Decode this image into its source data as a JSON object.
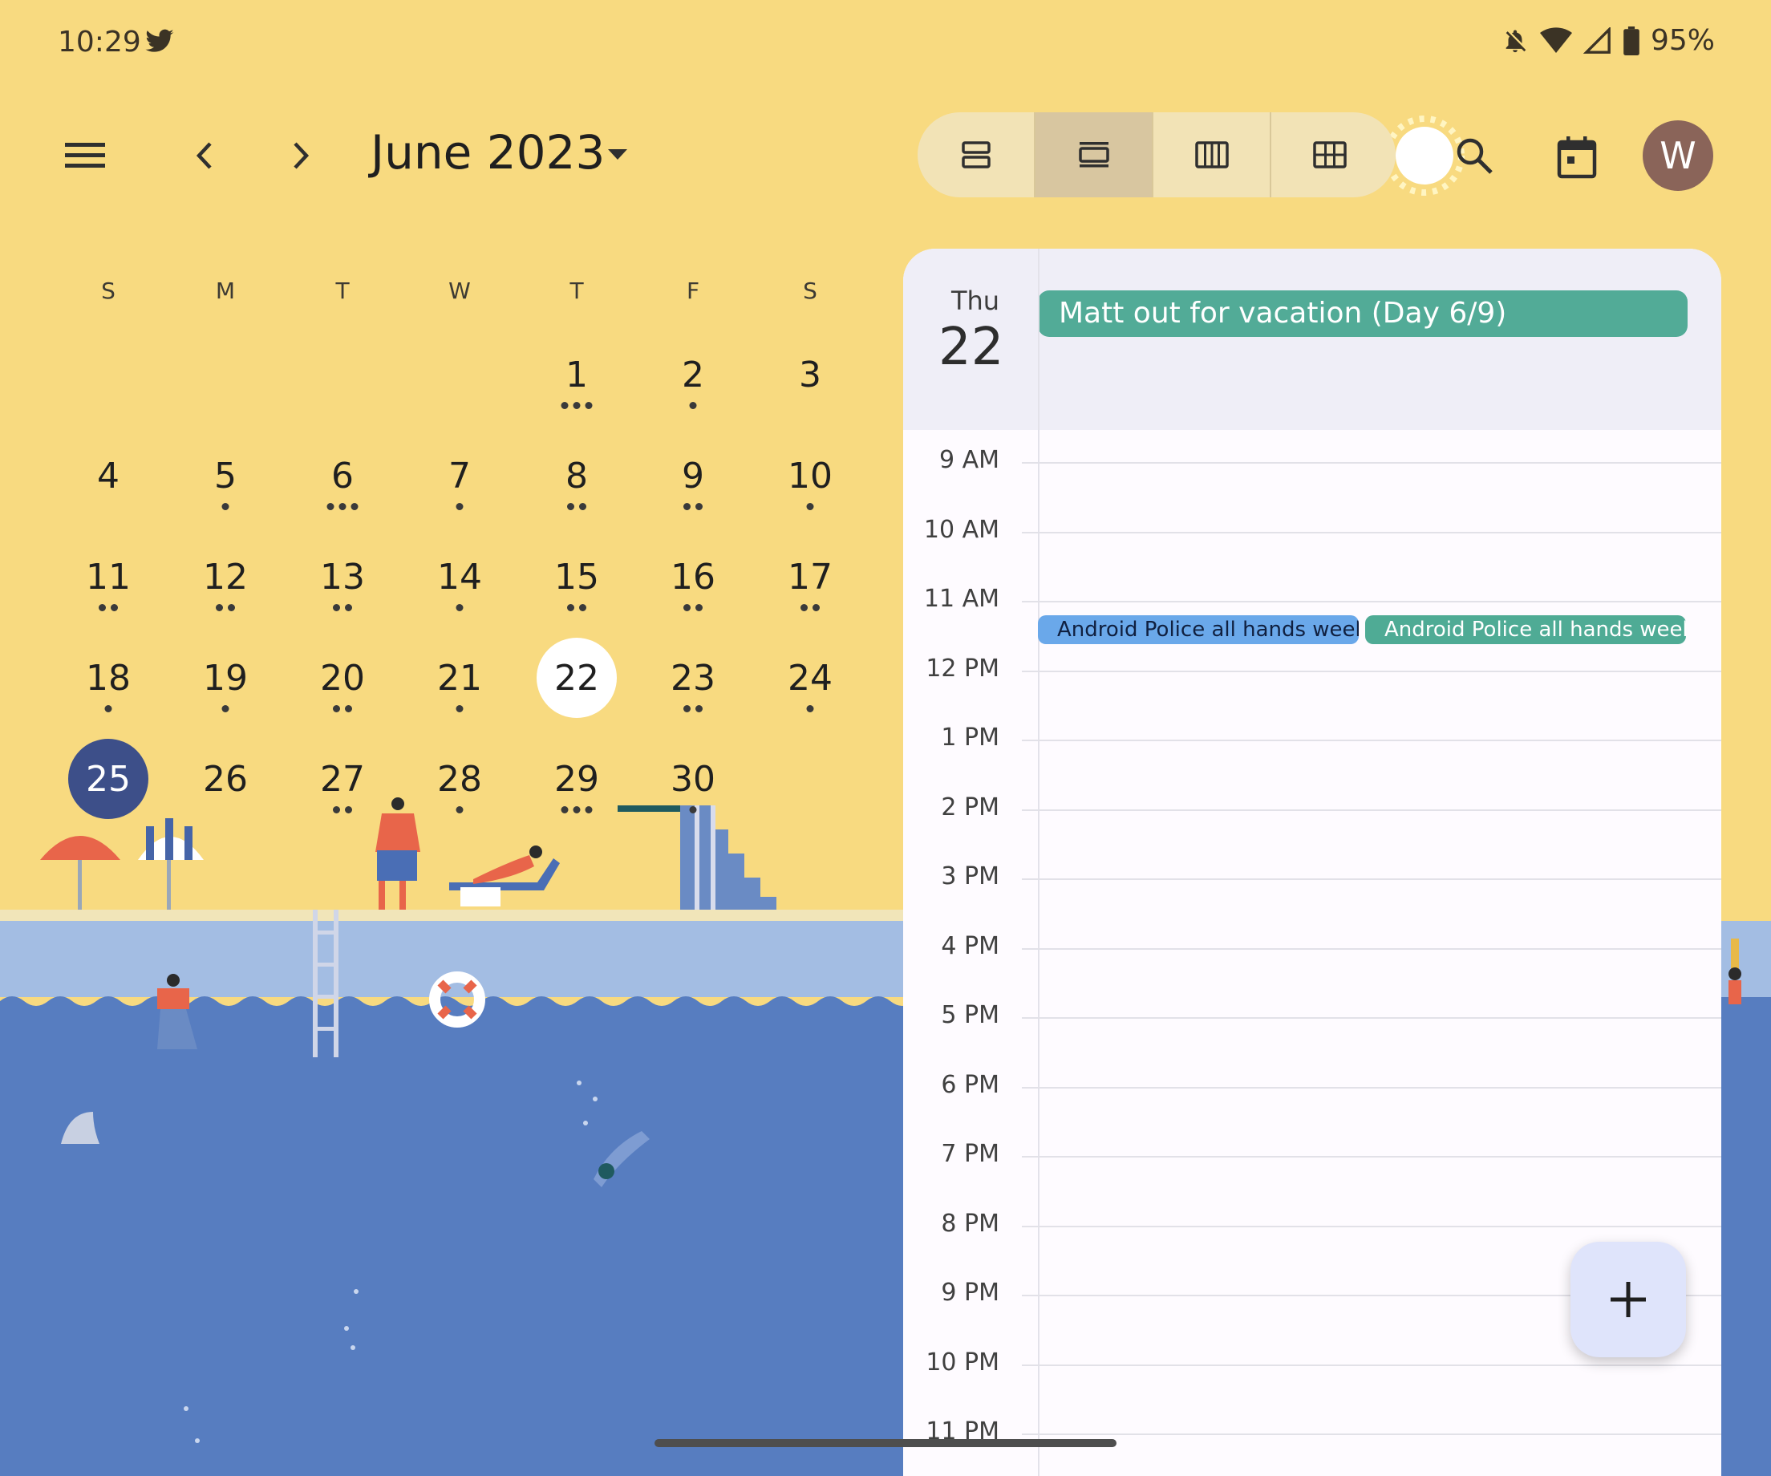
{
  "status_bar": {
    "time": "10:29",
    "battery": "95%"
  },
  "header": {
    "month_title": "June 2023",
    "avatar_letter": "W"
  },
  "view_modes": [
    "schedule-view",
    "day-view",
    "week-view",
    "month-view"
  ],
  "mini_calendar": {
    "weekdays": [
      "S",
      "M",
      "T",
      "W",
      "T",
      "F",
      "S"
    ],
    "weeks": [
      [
        {
          "day": "",
          "dots": 0
        },
        {
          "day": "",
          "dots": 0
        },
        {
          "day": "",
          "dots": 0
        },
        {
          "day": "",
          "dots": 0
        },
        {
          "day": "1",
          "dots": 3
        },
        {
          "day": "2",
          "dots": 1
        },
        {
          "day": "3",
          "dots": 0
        }
      ],
      [
        {
          "day": "4",
          "dots": 0
        },
        {
          "day": "5",
          "dots": 1
        },
        {
          "day": "6",
          "dots": 3
        },
        {
          "day": "7",
          "dots": 1
        },
        {
          "day": "8",
          "dots": 2
        },
        {
          "day": "9",
          "dots": 2
        },
        {
          "day": "10",
          "dots": 1
        }
      ],
      [
        {
          "day": "11",
          "dots": 2
        },
        {
          "day": "12",
          "dots": 2
        },
        {
          "day": "13",
          "dots": 2
        },
        {
          "day": "14",
          "dots": 1
        },
        {
          "day": "15",
          "dots": 2
        },
        {
          "day": "16",
          "dots": 2
        },
        {
          "day": "17",
          "dots": 2
        }
      ],
      [
        {
          "day": "18",
          "dots": 1
        },
        {
          "day": "19",
          "dots": 1
        },
        {
          "day": "20",
          "dots": 2
        },
        {
          "day": "21",
          "dots": 1
        },
        {
          "day": "22",
          "dots": 0,
          "state": "today"
        },
        {
          "day": "23",
          "dots": 2
        },
        {
          "day": "24",
          "dots": 1
        }
      ],
      [
        {
          "day": "25",
          "dots": 0,
          "state": "selected"
        },
        {
          "day": "26",
          "dots": 0
        },
        {
          "day": "27",
          "dots": 2
        },
        {
          "day": "28",
          "dots": 1
        },
        {
          "day": "29",
          "dots": 3
        },
        {
          "day": "30",
          "dots": 1
        },
        {
          "day": "",
          "dots": 0
        }
      ]
    ]
  },
  "day_view": {
    "weekday": "Thu",
    "day_number": "22",
    "all_day_event": "Matt out for vacation (Day 6/9)",
    "hours": [
      "9 AM",
      "10 AM",
      "11 AM",
      "12 PM",
      "1 PM",
      "2 PM",
      "3 PM",
      "4 PM",
      "5 PM",
      "6 PM",
      "7 PM",
      "8 PM",
      "9 PM",
      "10 PM",
      "11 PM"
    ],
    "events": [
      {
        "title": "Android Police all hands weekly",
        "color": "#6aa8ea",
        "style": "blue"
      },
      {
        "title": "Android Police all hands weekly",
        "color": "#4fab95",
        "style": "teal"
      }
    ]
  },
  "colors": {
    "background": "#f8da80",
    "water": "#577dc0",
    "selected_day": "#3d4f89",
    "allday_event": "#52ab97"
  }
}
